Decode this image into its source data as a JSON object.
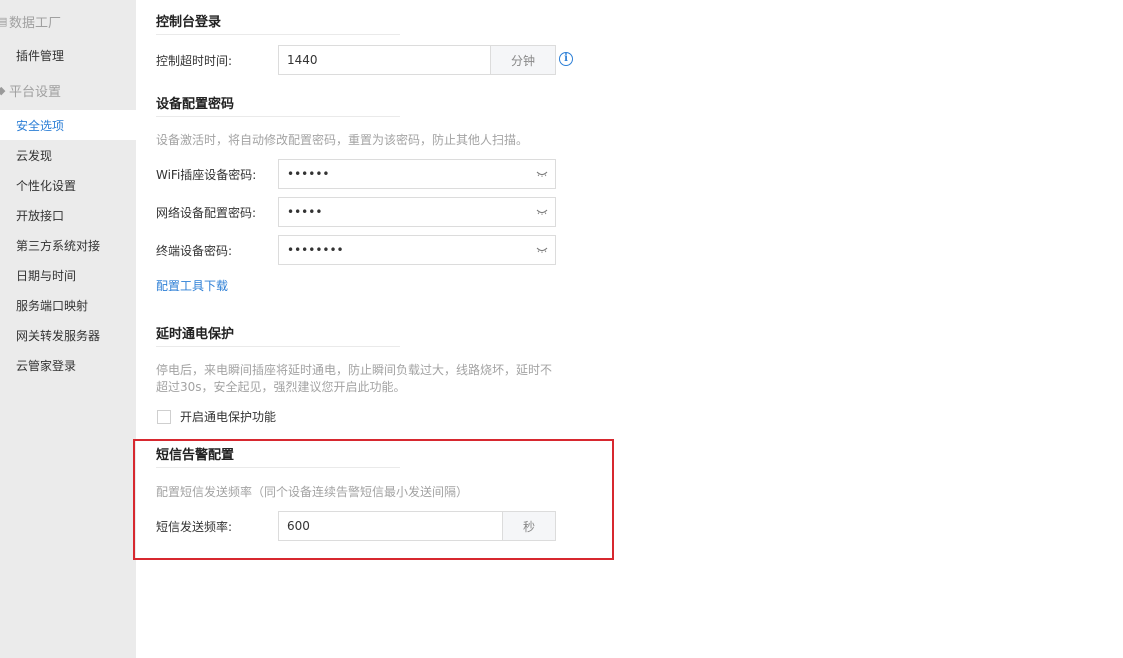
{
  "sidebar": {
    "groups": [
      {
        "label": "数据工厂",
        "icon": "database-icon"
      },
      {
        "label": "平台设置",
        "icon": "settings-icon"
      }
    ],
    "items": [
      {
        "label": "插件管理"
      },
      {
        "label": "安全选项"
      },
      {
        "label": "云发现"
      },
      {
        "label": "个性化设置"
      },
      {
        "label": "开放接口"
      },
      {
        "label": "第三方系统对接"
      },
      {
        "label": "日期与时间"
      },
      {
        "label": "服务端口映射"
      },
      {
        "label": "网关转发服务器"
      },
      {
        "label": "云管家登录"
      }
    ],
    "active_item": "安全选项"
  },
  "console_login": {
    "title": "控制台登录",
    "timeout_label": "控制超时时间:",
    "timeout_value": "1440",
    "timeout_unit": "分钟"
  },
  "device_password": {
    "title": "设备配置密码",
    "description": "设备激活时，将自动修改配置密码，重置为该密码，防止其他人扫描。",
    "fields": [
      {
        "label": "WiFi插座设备密码:",
        "value": "••••••"
      },
      {
        "label": "网络设备配置密码:",
        "value": "•••••"
      },
      {
        "label": "终端设备密码:",
        "value": "••••••••"
      }
    ],
    "download_link": "配置工具下载"
  },
  "delay_power": {
    "title": "延时通电保护",
    "description_line1": "停电后，来电瞬间插座将延时通电，防止瞬间负载过大，线路烧坏，延时不",
    "description_line2": "超过30s，安全起见，强烈建议您开启此功能。",
    "checkbox_label": "开启通电保护功能",
    "checked": false
  },
  "sms_alert": {
    "title": "短信告警配置",
    "description": "配置短信发送频率（同个设备连续告警短信最小发送间隔）",
    "freq_label": "短信发送频率:",
    "freq_value": "600",
    "freq_unit": "秒"
  },
  "colors": {
    "accent": "#2d7fd6",
    "highlight": "#d7282f",
    "sidebar_bg": "#ebebeb"
  }
}
